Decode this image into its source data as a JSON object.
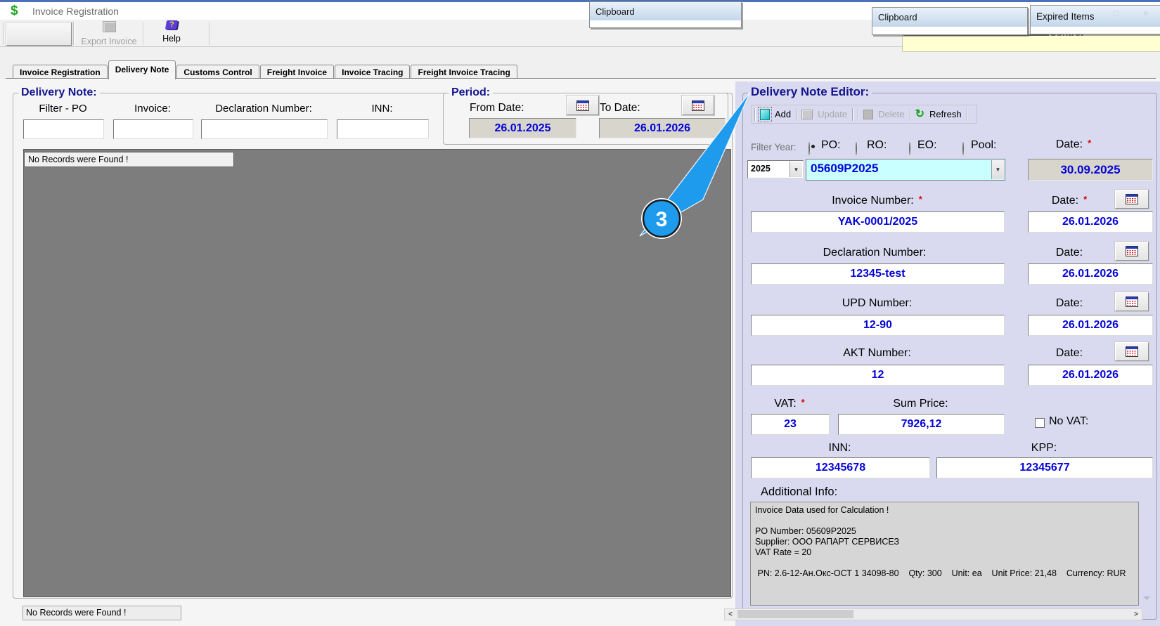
{
  "window": {
    "title": "Invoice Registration"
  },
  "toolbar": {
    "export_label": "Export Invoice",
    "help_label": "Help"
  },
  "tabs": [
    "Invoice Registration",
    "Delivery Note",
    "Customs Control",
    "Freight Invoice",
    "Invoice Tracing",
    "Freight Invoice Tracing"
  ],
  "popups": {
    "clipboard_a": "Clipboard",
    "clipboard_b": "Clipboard",
    "expired": "Expired Items",
    "partial_text": "Control"
  },
  "left": {
    "title": "Delivery Note:",
    "filter_labels": [
      "Filter - PO",
      "Invoice:",
      "Declaration Number:",
      "INN:"
    ],
    "no_records": "No Records were Found !",
    "status": "No Records were Found !"
  },
  "period": {
    "title": "Period:",
    "from_label": "From Date:",
    "from_value": "26.01.2025",
    "to_label": "To Date:",
    "to_value": "26.01.2026"
  },
  "editor": {
    "title": "Delivery Note Editor:",
    "toolbar": {
      "add": "Add",
      "update": "Update",
      "delete": "Delete",
      "refresh": "Refresh"
    },
    "filter_year_label": "Filter Year:",
    "filter_year_value": "2025",
    "radios": [
      {
        "label": "PO:",
        "selected": true
      },
      {
        "label": "RO:",
        "selected": false
      },
      {
        "label": "EO:",
        "selected": false
      },
      {
        "label": "Pool:",
        "selected": false
      }
    ],
    "po_value": "05609P2025",
    "po_date_label": "Date:",
    "po_date_star": "*",
    "po_date_value": "30.09.2025",
    "fields": [
      {
        "label": "Invoice Number:",
        "star": "*",
        "value": "YAK-0001/2025",
        "date_label": "Date:",
        "date_star": "*",
        "date_value": "26.01.2026"
      },
      {
        "label": "Declaration Number:",
        "value": "12345-test",
        "date_label": "Date:",
        "date_value": "26.01.2026"
      },
      {
        "label": "UPD Number:",
        "value": "12-90",
        "date_label": "Date:",
        "date_value": "26.01.2026"
      },
      {
        "label": "AKT Number:",
        "value": "12",
        "date_label": "Date:",
        "date_value": "26.01.2026"
      }
    ],
    "vat_label": "VAT:",
    "vat_star": "*",
    "vat_value": "23",
    "sum_label": "Sum Price:",
    "sum_value": "7926,12",
    "no_vat_label": "No VAT:",
    "inn_label": "INN:",
    "inn_value": "12345678",
    "kpp_label": "KPP:",
    "kpp_value": "12345677",
    "additional_label": "Additional Info:",
    "additional_text": "Invoice Data used for Calculation !\n\nPO Number: 05609P2025\nSupplier: ООО РАПАРТ СЕРВИСЕЗ\nVAT Rate = 20\n\n PN: 2.6-12-Ан.Окс-ОСТ 1 34098-80    Qty: 300    Unit: ea    Unit Price: 21,48    Currency: RUR"
  },
  "annotation": {
    "badge": "3"
  },
  "colors": {
    "title_blue": "#14148e",
    "value_blue": "#0404d8",
    "panel_lavender": "#d9daef",
    "grid_gray": "#7d7d7d",
    "combo_cyan": "#c9ffff",
    "readonly_gray": "#d8d5cd",
    "highlight_yellow": "#ffffd2",
    "callout_blue": "#1e9bec",
    "required_red": "#e00000"
  }
}
